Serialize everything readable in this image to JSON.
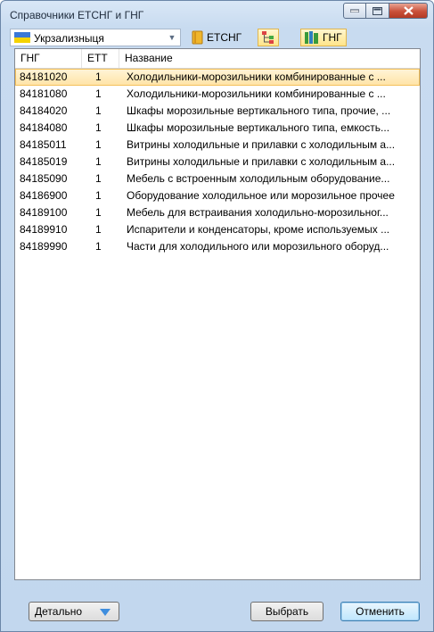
{
  "window": {
    "title": "Справочники ЕТСНГ и ГНГ"
  },
  "toolbar": {
    "railway_select": "Укрзализныця",
    "etsng_label": "ЕТСНГ",
    "gng_label": "ГНГ"
  },
  "columns": {
    "gng": "ГНГ",
    "ett": "ЕТТ",
    "name": "Название"
  },
  "rows": [
    {
      "gng": "84181020",
      "ett": "1",
      "name": "Холодильники-морозильники комбинированные с ..."
    },
    {
      "gng": "84181080",
      "ett": "1",
      "name": "Холодильники-морозильники комбинированные с ..."
    },
    {
      "gng": "84184020",
      "ett": "1",
      "name": "Шкафы морозильные вертикального типа, прочие, ..."
    },
    {
      "gng": "84184080",
      "ett": "1",
      "name": "Шкафы морозильные вертикального типа, емкость..."
    },
    {
      "gng": "84185011",
      "ett": "1",
      "name": "Витрины холодильные и прилавки с холодильным а..."
    },
    {
      "gng": "84185019",
      "ett": "1",
      "name": "Витрины холодильные и прилавки с холодильным а..."
    },
    {
      "gng": "84185090",
      "ett": "1",
      "name": "Мебель с встроенным холодильным оборудование..."
    },
    {
      "gng": "84186900",
      "ett": "1",
      "name": "Оборудование холодильное или морозильное прочее"
    },
    {
      "gng": "84189100",
      "ett": "1",
      "name": "Мебель для встраивания холодильно-морозильног..."
    },
    {
      "gng": "84189910",
      "ett": "1",
      "name": "Испарители и конденсаторы, кроме используемых ..."
    },
    {
      "gng": "84189990",
      "ett": "1",
      "name": "Части для холодильного или морозильного оборуд..."
    }
  ],
  "footer": {
    "details": "Детально",
    "select": "Выбрать",
    "cancel": "Отменить"
  }
}
